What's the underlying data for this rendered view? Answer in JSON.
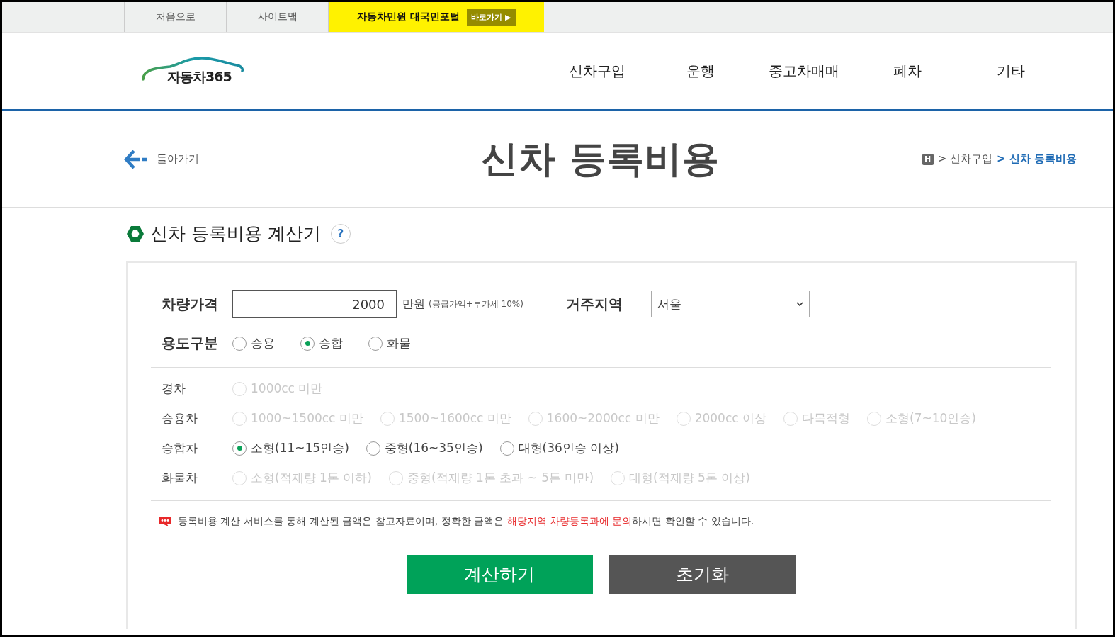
{
  "top_links": [
    {
      "label": "처음으로"
    },
    {
      "label": "사이트맵"
    }
  ],
  "portal": {
    "label": "자동차민원 대국민포털",
    "button": "바로가기 ▶"
  },
  "logo": {
    "text": "자동차365"
  },
  "nav": [
    {
      "label": "신차구입"
    },
    {
      "label": "운행"
    },
    {
      "label": "중고차매매"
    },
    {
      "label": "폐차"
    },
    {
      "label": "기타"
    }
  ],
  "back": {
    "label": "돌아가기"
  },
  "page_title": "신차 등록비용",
  "breadcrumb": {
    "home": "H",
    "items": [
      {
        "label": "> 신차구입",
        "current": false
      },
      {
        "label": "> 신차 등록비용",
        "current": true
      }
    ]
  },
  "section_title": "신차 등록비용 계산기",
  "help": "?",
  "form": {
    "price_label": "차량가격",
    "price_value": "2000",
    "unit": "만원",
    "unit_note": "(공급가액+부가세 10%)",
    "region_label": "거주지역",
    "region_value": "서울"
  },
  "usage": {
    "label": "용도구분",
    "options": [
      {
        "label": "승용",
        "selected": false
      },
      {
        "label": "승합",
        "selected": true
      },
      {
        "label": "화물",
        "selected": false
      }
    ]
  },
  "categories": [
    {
      "label": "경차",
      "disabled": true,
      "options": [
        {
          "label": "1000cc 미만",
          "selected": false
        }
      ]
    },
    {
      "label": "승용차",
      "disabled": true,
      "options": [
        {
          "label": "1000~1500cc 미만",
          "selected": false
        },
        {
          "label": "1500~1600cc 미만",
          "selected": false
        },
        {
          "label": "1600~2000cc 미만",
          "selected": false
        },
        {
          "label": "2000cc 이상",
          "selected": false
        },
        {
          "label": "다목적형",
          "selected": false
        },
        {
          "label": "소형(7~10인승)",
          "selected": false
        }
      ]
    },
    {
      "label": "승합차",
      "disabled": false,
      "options": [
        {
          "label": "소형(11~15인승)",
          "selected": true
        },
        {
          "label": "중형(16~35인승)",
          "selected": false
        },
        {
          "label": "대형(36인승 이상)",
          "selected": false
        }
      ]
    },
    {
      "label": "화물차",
      "disabled": true,
      "options": [
        {
          "label": "소형(적재량 1톤 이하)",
          "selected": false
        },
        {
          "label": "중형(적재량 1톤 초과 ~ 5톤 미만)",
          "selected": false
        },
        {
          "label": "대형(적재량 5톤 이상)",
          "selected": false
        }
      ]
    }
  ],
  "note": {
    "before": "등록비용 계산 서비스를 통해 계산된 금액은 참고자료이며, 정확한 금액은 ",
    "highlight": "해당지역 차량등록과에 문의",
    "after": "하시면 확인할 수 있습니다."
  },
  "buttons": [
    {
      "label": "계산하기",
      "kind": "primary"
    },
    {
      "label": "초기화",
      "kind": "secondary"
    }
  ]
}
